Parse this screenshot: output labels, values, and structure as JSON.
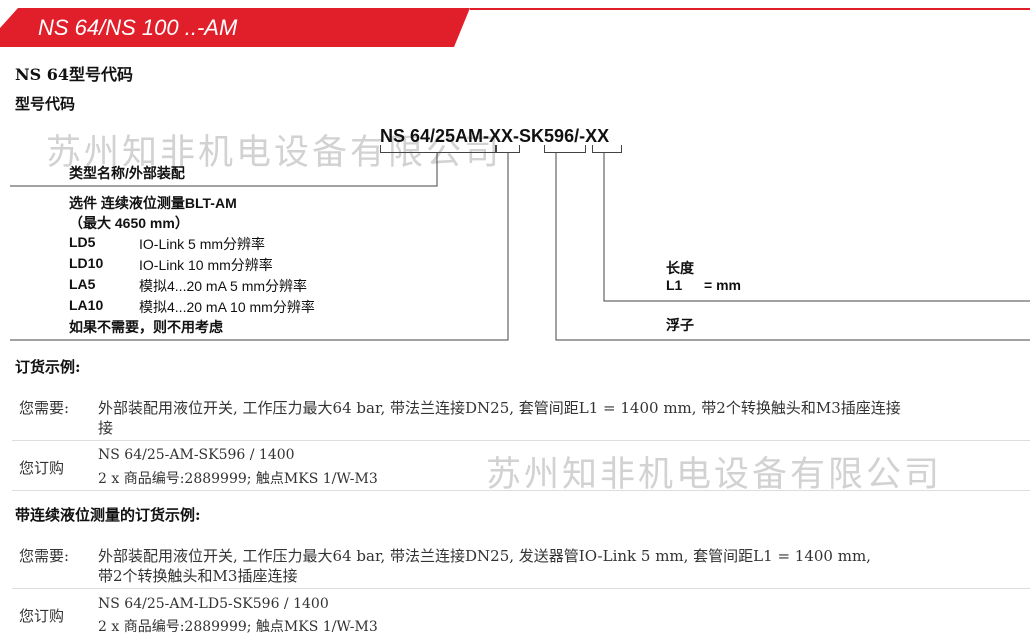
{
  "header": {
    "title": "NS 64/NS 100 ..-AM",
    "accent_color": "#e11f2b"
  },
  "section_title": "NS 64型号代码",
  "subsection_title": "型号代码",
  "model_code": "NS 64/25AM-XX-SK596/-XX",
  "watermark": "苏州知非机电设备有限公司",
  "diagram": {
    "type_label": "类型名称/外部装配",
    "options_title": "选件 连续液位测量BLT-AM",
    "options_subtitle": "（最大 4650 mm）",
    "options": [
      {
        "code": "LD5",
        "desc": "IO-Link 5 mm分辨率"
      },
      {
        "code": "LD10",
        "desc": "IO-Link 10 mm分辨率"
      },
      {
        "code": "LA5",
        "desc": "模拟4...20 mA 5 mm分辨率"
      },
      {
        "code": "LA10",
        "desc": "模拟4...20 mA 10 mm分辨率"
      }
    ],
    "options_note": "如果不需要，则不用考虑",
    "length_label": "长度",
    "length_code": "L1",
    "length_unit": "= mm",
    "float_label": "浮子"
  },
  "example1": {
    "title": "订货示例:",
    "need_label": "您需要:",
    "need_text_line1": "外部装配用液位开关, 工作压力最大64  bar, 带法兰连接DN25, 套管间距L1 = 1400  mm, 带2个转换触头和M3插座连接",
    "need_text_line2": "接",
    "order_label": "您订购",
    "order_line1": "NS 64/25-AM-SK596 / 1400",
    "order_line2": "2 x 商品编号:2889999; 触点MKS 1/W-M3"
  },
  "example2": {
    "title": "带连续液位测量的订货示例:",
    "need_label": "您需要:",
    "need_text_line1": "外部装配用液位开关, 工作压力最大64  bar, 带法兰连接DN25, 发送器管IO-Link 5  mm, 套管间距L1 = 1400  mm,",
    "need_text_line2": "带2个转换触头和M3插座连接",
    "order_label": "您订购",
    "order_line1": "NS 64/25-AM-LD5-SK596 / 1400",
    "order_line2": "2 x 商品编号:2889999; 触点MKS 1/W-M3"
  }
}
